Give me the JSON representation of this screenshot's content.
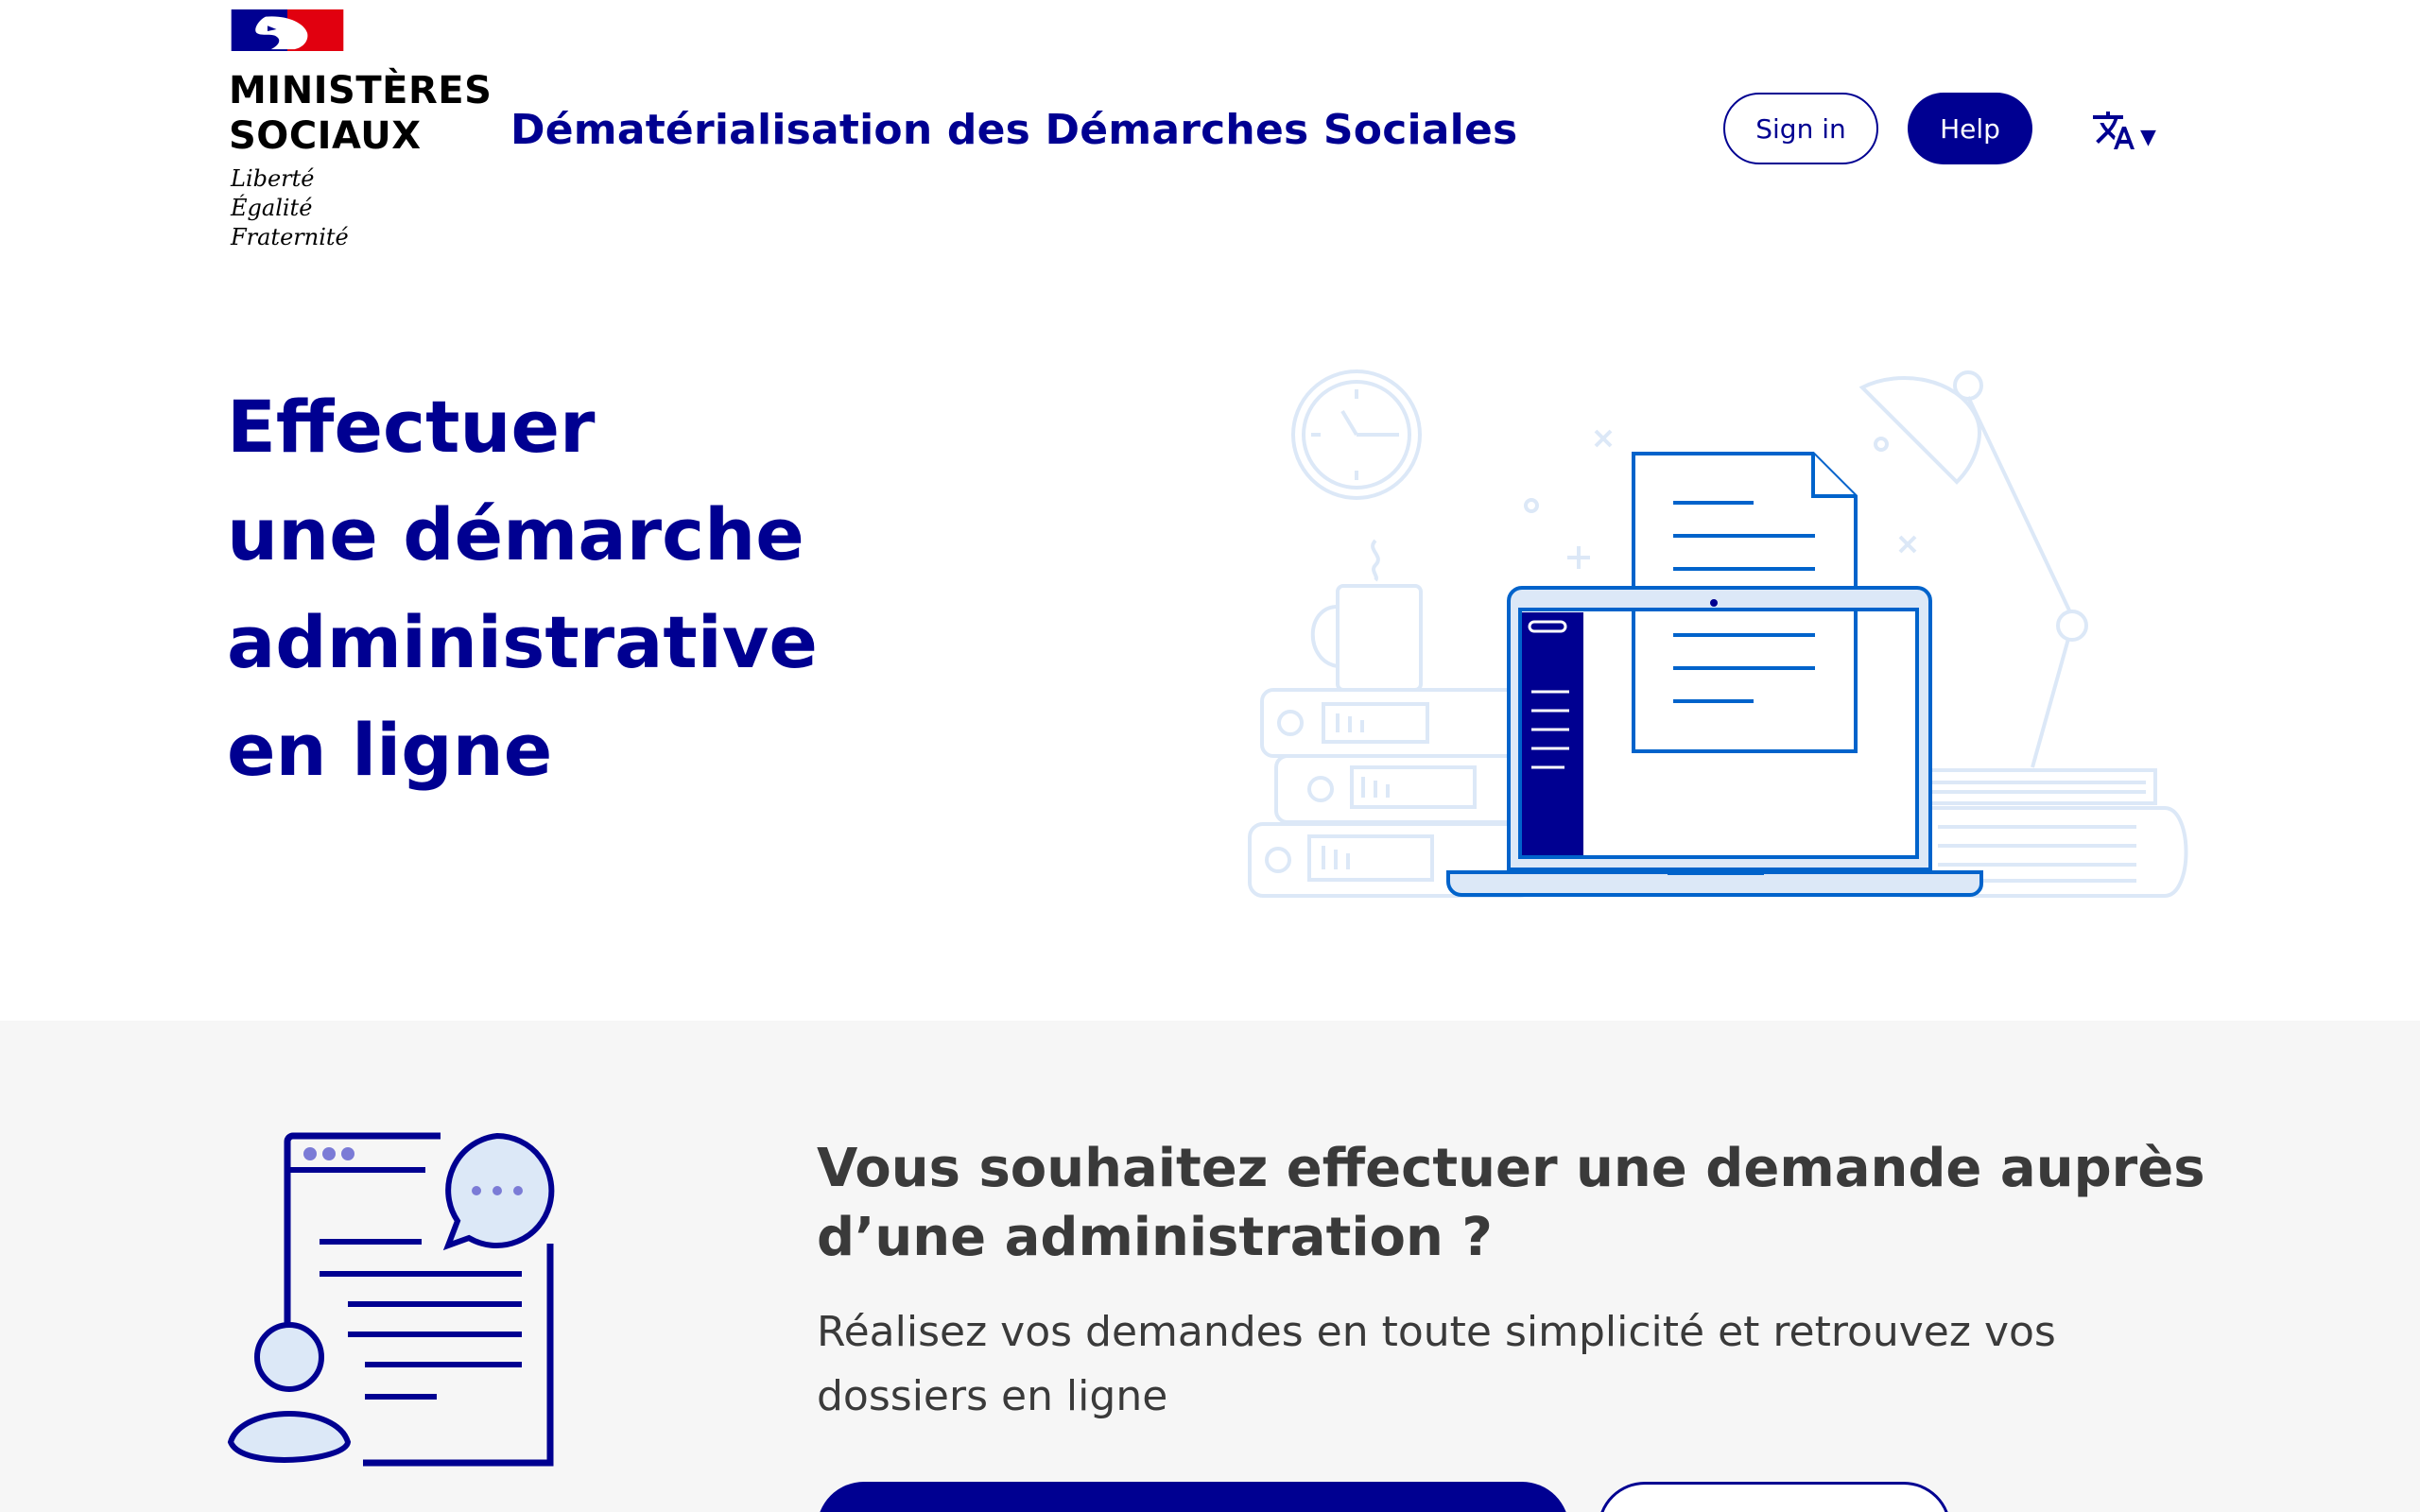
{
  "header": {
    "ministry_name": "MINISTÈRES\nSOCIAUX",
    "motto": "Liberté\nÉgalité\nFraternité",
    "site_title": "Dématérialisation des Démarches Sociales",
    "sign_in_label": "Sign in",
    "help_label": "Help",
    "language_icon": "translate-icon"
  },
  "hero": {
    "title_lines": [
      "Effectuer",
      "une démarche",
      "administrative",
      "en ligne"
    ]
  },
  "band": {
    "title": "Vous souhaitez effectuer une demande auprès d’une administration ?",
    "text": "Réalisez vos demandes en toute simplicité et retrouvez vos dossiers en ligne"
  },
  "colors": {
    "brand_blue": "#000091",
    "marianne_red": "#e1000f",
    "illustration_blue": "#0063cb",
    "illustration_light": "#dce8f7",
    "band_background": "#f6f6f6",
    "text_grey": "#3a3a3a"
  }
}
